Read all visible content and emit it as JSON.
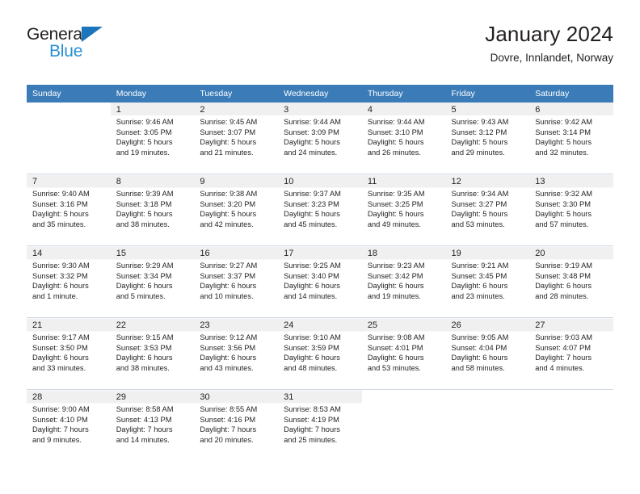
{
  "brand": {
    "name_dark": "General",
    "name_blue": "Blue",
    "accent_color": "#2a8fd4",
    "triangle_color": "#1b75bc"
  },
  "header": {
    "title": "January 2024",
    "subtitle": "Dovre, Innlandet, Norway"
  },
  "calendar": {
    "header_bg": "#3b7cb8",
    "day_headers": [
      "Sunday",
      "Monday",
      "Tuesday",
      "Wednesday",
      "Thursday",
      "Friday",
      "Saturday"
    ],
    "weeks": [
      [
        {
          "day": "",
          "sunrise": "",
          "sunset": "",
          "daylight1": "",
          "daylight2": ""
        },
        {
          "day": "1",
          "sunrise": "Sunrise: 9:46 AM",
          "sunset": "Sunset: 3:05 PM",
          "daylight1": "Daylight: 5 hours",
          "daylight2": "and 19 minutes."
        },
        {
          "day": "2",
          "sunrise": "Sunrise: 9:45 AM",
          "sunset": "Sunset: 3:07 PM",
          "daylight1": "Daylight: 5 hours",
          "daylight2": "and 21 minutes."
        },
        {
          "day": "3",
          "sunrise": "Sunrise: 9:44 AM",
          "sunset": "Sunset: 3:09 PM",
          "daylight1": "Daylight: 5 hours",
          "daylight2": "and 24 minutes."
        },
        {
          "day": "4",
          "sunrise": "Sunrise: 9:44 AM",
          "sunset": "Sunset: 3:10 PM",
          "daylight1": "Daylight: 5 hours",
          "daylight2": "and 26 minutes."
        },
        {
          "day": "5",
          "sunrise": "Sunrise: 9:43 AM",
          "sunset": "Sunset: 3:12 PM",
          "daylight1": "Daylight: 5 hours",
          "daylight2": "and 29 minutes."
        },
        {
          "day": "6",
          "sunrise": "Sunrise: 9:42 AM",
          "sunset": "Sunset: 3:14 PM",
          "daylight1": "Daylight: 5 hours",
          "daylight2": "and 32 minutes."
        }
      ],
      [
        {
          "day": "7",
          "sunrise": "Sunrise: 9:40 AM",
          "sunset": "Sunset: 3:16 PM",
          "daylight1": "Daylight: 5 hours",
          "daylight2": "and 35 minutes."
        },
        {
          "day": "8",
          "sunrise": "Sunrise: 9:39 AM",
          "sunset": "Sunset: 3:18 PM",
          "daylight1": "Daylight: 5 hours",
          "daylight2": "and 38 minutes."
        },
        {
          "day": "9",
          "sunrise": "Sunrise: 9:38 AM",
          "sunset": "Sunset: 3:20 PM",
          "daylight1": "Daylight: 5 hours",
          "daylight2": "and 42 minutes."
        },
        {
          "day": "10",
          "sunrise": "Sunrise: 9:37 AM",
          "sunset": "Sunset: 3:23 PM",
          "daylight1": "Daylight: 5 hours",
          "daylight2": "and 45 minutes."
        },
        {
          "day": "11",
          "sunrise": "Sunrise: 9:35 AM",
          "sunset": "Sunset: 3:25 PM",
          "daylight1": "Daylight: 5 hours",
          "daylight2": "and 49 minutes."
        },
        {
          "day": "12",
          "sunrise": "Sunrise: 9:34 AM",
          "sunset": "Sunset: 3:27 PM",
          "daylight1": "Daylight: 5 hours",
          "daylight2": "and 53 minutes."
        },
        {
          "day": "13",
          "sunrise": "Sunrise: 9:32 AM",
          "sunset": "Sunset: 3:30 PM",
          "daylight1": "Daylight: 5 hours",
          "daylight2": "and 57 minutes."
        }
      ],
      [
        {
          "day": "14",
          "sunrise": "Sunrise: 9:30 AM",
          "sunset": "Sunset: 3:32 PM",
          "daylight1": "Daylight: 6 hours",
          "daylight2": "and 1 minute."
        },
        {
          "day": "15",
          "sunrise": "Sunrise: 9:29 AM",
          "sunset": "Sunset: 3:34 PM",
          "daylight1": "Daylight: 6 hours",
          "daylight2": "and 5 minutes."
        },
        {
          "day": "16",
          "sunrise": "Sunrise: 9:27 AM",
          "sunset": "Sunset: 3:37 PM",
          "daylight1": "Daylight: 6 hours",
          "daylight2": "and 10 minutes."
        },
        {
          "day": "17",
          "sunrise": "Sunrise: 9:25 AM",
          "sunset": "Sunset: 3:40 PM",
          "daylight1": "Daylight: 6 hours",
          "daylight2": "and 14 minutes."
        },
        {
          "day": "18",
          "sunrise": "Sunrise: 9:23 AM",
          "sunset": "Sunset: 3:42 PM",
          "daylight1": "Daylight: 6 hours",
          "daylight2": "and 19 minutes."
        },
        {
          "day": "19",
          "sunrise": "Sunrise: 9:21 AM",
          "sunset": "Sunset: 3:45 PM",
          "daylight1": "Daylight: 6 hours",
          "daylight2": "and 23 minutes."
        },
        {
          "day": "20",
          "sunrise": "Sunrise: 9:19 AM",
          "sunset": "Sunset: 3:48 PM",
          "daylight1": "Daylight: 6 hours",
          "daylight2": "and 28 minutes."
        }
      ],
      [
        {
          "day": "21",
          "sunrise": "Sunrise: 9:17 AM",
          "sunset": "Sunset: 3:50 PM",
          "daylight1": "Daylight: 6 hours",
          "daylight2": "and 33 minutes."
        },
        {
          "day": "22",
          "sunrise": "Sunrise: 9:15 AM",
          "sunset": "Sunset: 3:53 PM",
          "daylight1": "Daylight: 6 hours",
          "daylight2": "and 38 minutes."
        },
        {
          "day": "23",
          "sunrise": "Sunrise: 9:12 AM",
          "sunset": "Sunset: 3:56 PM",
          "daylight1": "Daylight: 6 hours",
          "daylight2": "and 43 minutes."
        },
        {
          "day": "24",
          "sunrise": "Sunrise: 9:10 AM",
          "sunset": "Sunset: 3:59 PM",
          "daylight1": "Daylight: 6 hours",
          "daylight2": "and 48 minutes."
        },
        {
          "day": "25",
          "sunrise": "Sunrise: 9:08 AM",
          "sunset": "Sunset: 4:01 PM",
          "daylight1": "Daylight: 6 hours",
          "daylight2": "and 53 minutes."
        },
        {
          "day": "26",
          "sunrise": "Sunrise: 9:05 AM",
          "sunset": "Sunset: 4:04 PM",
          "daylight1": "Daylight: 6 hours",
          "daylight2": "and 58 minutes."
        },
        {
          "day": "27",
          "sunrise": "Sunrise: 9:03 AM",
          "sunset": "Sunset: 4:07 PM",
          "daylight1": "Daylight: 7 hours",
          "daylight2": "and 4 minutes."
        }
      ],
      [
        {
          "day": "28",
          "sunrise": "Sunrise: 9:00 AM",
          "sunset": "Sunset: 4:10 PM",
          "daylight1": "Daylight: 7 hours",
          "daylight2": "and 9 minutes."
        },
        {
          "day": "29",
          "sunrise": "Sunrise: 8:58 AM",
          "sunset": "Sunset: 4:13 PM",
          "daylight1": "Daylight: 7 hours",
          "daylight2": "and 14 minutes."
        },
        {
          "day": "30",
          "sunrise": "Sunrise: 8:55 AM",
          "sunset": "Sunset: 4:16 PM",
          "daylight1": "Daylight: 7 hours",
          "daylight2": "and 20 minutes."
        },
        {
          "day": "31",
          "sunrise": "Sunrise: 8:53 AM",
          "sunset": "Sunset: 4:19 PM",
          "daylight1": "Daylight: 7 hours",
          "daylight2": "and 25 minutes."
        },
        {
          "day": "",
          "sunrise": "",
          "sunset": "",
          "daylight1": "",
          "daylight2": ""
        },
        {
          "day": "",
          "sunrise": "",
          "sunset": "",
          "daylight1": "",
          "daylight2": ""
        },
        {
          "day": "",
          "sunrise": "",
          "sunset": "",
          "daylight1": "",
          "daylight2": ""
        }
      ]
    ]
  }
}
